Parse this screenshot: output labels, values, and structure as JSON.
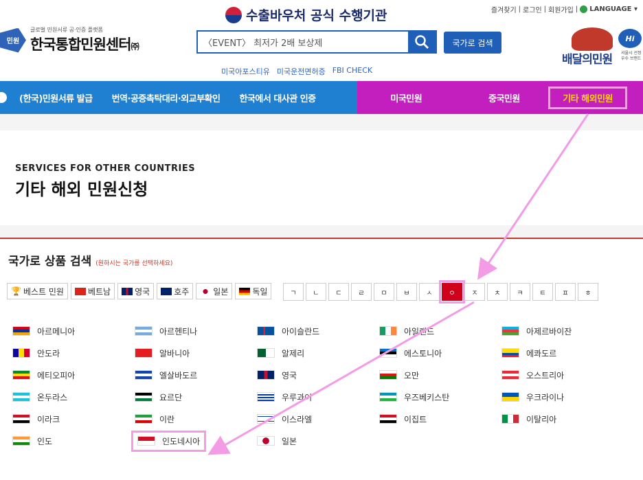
{
  "top_links": {
    "favorites": "즐겨찾기",
    "login": "로그인",
    "signup": "회원가입",
    "language": "LANGUAGE ▾",
    "sep": "|"
  },
  "banner": {
    "text": "수출바우처 공식 수행기관"
  },
  "logo": {
    "badge": "민원",
    "sub": "글로벌 민원서류 공·인증 플랫폼",
    "main": "한국통합민원센터",
    "suffix": "㈜"
  },
  "search": {
    "value": "〈EVENT〉 최저가 2배 보상제",
    "button": "국가로 검색"
  },
  "quick_links": [
    "미국아포스티유",
    "미국운전면허증",
    "FBI CHECK"
  ],
  "promo": {
    "badge": "Hi",
    "title": "배달의민원",
    "small1": "서울시 선정",
    "small2": "우수 브랜드"
  },
  "nav": {
    "blue": [
      "(한국)민원서류 발급",
      "번역·공증촉탁대리·외교부확인",
      "한국에서 대사관 인증"
    ],
    "magenta": [
      "미국민원",
      "중국민원",
      "기타 해외민원"
    ]
  },
  "title": {
    "eng": "SERVICES FOR OTHER COUNTRIES",
    "kor": "기타 해외 민원신청"
  },
  "product_search": {
    "title": "국가로 상품 검색",
    "hint": "(원하시는 국가를 선택하세요)"
  },
  "filters": [
    {
      "label": "베스트 민원",
      "icon": "trophy-icon"
    },
    {
      "label": "베트남",
      "icon": "vietnam-flag-icon"
    },
    {
      "label": "영국",
      "icon": "uk-flag-icon"
    },
    {
      "label": "호주",
      "icon": "australia-flag-icon"
    },
    {
      "label": "일본",
      "icon": "japan-flag-icon"
    },
    {
      "label": "독일",
      "icon": "germany-flag-icon"
    }
  ],
  "consonants": [
    "ㄱ",
    "ㄴ",
    "ㄷ",
    "ㄹ",
    "ㅁ",
    "ㅂ",
    "ㅅ",
    "ㅇ",
    "ㅈ",
    "ㅊ",
    "ㅋ",
    "ㅌ",
    "ㅍ",
    "ㅎ"
  ],
  "active_consonant": "ㅇ",
  "countries": [
    [
      "아르메니아",
      "아르헨티나",
      "아이슬란드",
      "아일랜드",
      "아제르바이잔"
    ],
    [
      "안도라",
      "알바니아",
      "알제리",
      "에스토니아",
      "에콰도르"
    ],
    [
      "에티오피아",
      "엘살바도르",
      "영국",
      "오만",
      "오스트리아"
    ],
    [
      "온두라스",
      "요르단",
      "우루과이",
      "우즈베키스탄",
      "우크라이나"
    ],
    [
      "이라크",
      "이란",
      "이스라엘",
      "이집트",
      "이탈리아"
    ],
    [
      "인도",
      "인도네시아",
      "일본"
    ]
  ],
  "highlighted_country": "인도네시아",
  "colors": {
    "blue": "#1f7fd1",
    "magenta": "#c31fbf",
    "highlight": "#f39be5",
    "active_red": "#d0021b"
  }
}
